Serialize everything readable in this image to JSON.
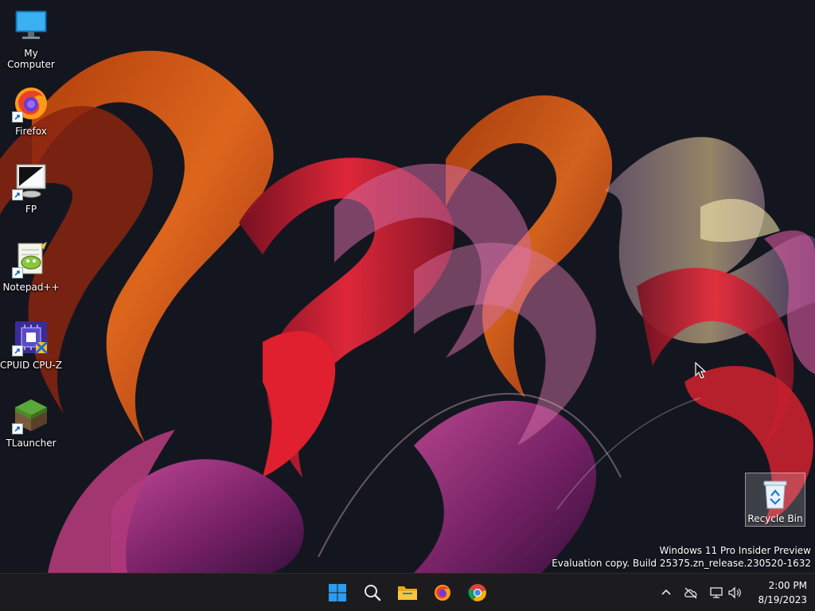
{
  "desktop_icons": [
    {
      "label": "My Computer"
    },
    {
      "label": "Firefox"
    },
    {
      "label": "FP"
    },
    {
      "label": "Notepad++"
    },
    {
      "label": "CPUID CPU-Z"
    },
    {
      "label": "TLauncher"
    }
  ],
  "recycle_bin": {
    "label": "Recycle Bin"
  },
  "watermark": {
    "line1": "Windows 11 Pro Insider Preview",
    "line2": "Evaluation copy. Build 25375.zn_release.230520-1632"
  },
  "taskbar": {
    "apps": [
      "start-icon",
      "search-icon",
      "file-explorer-icon",
      "firefox-icon",
      "chrome-icon"
    ],
    "tray": [
      "chevron-up-icon",
      "cloud-offline-icon",
      "network-icon",
      "volume-icon"
    ],
    "time": "2:00 PM",
    "date": "8/19/2023"
  },
  "colors": {
    "background": "#14161f",
    "taskbar": "#1c1c1f",
    "accent_orange": "#e0601a",
    "accent_red": "#c0182c",
    "accent_purple": "#8a2a6a",
    "start_blue": "#2c9cf0"
  }
}
